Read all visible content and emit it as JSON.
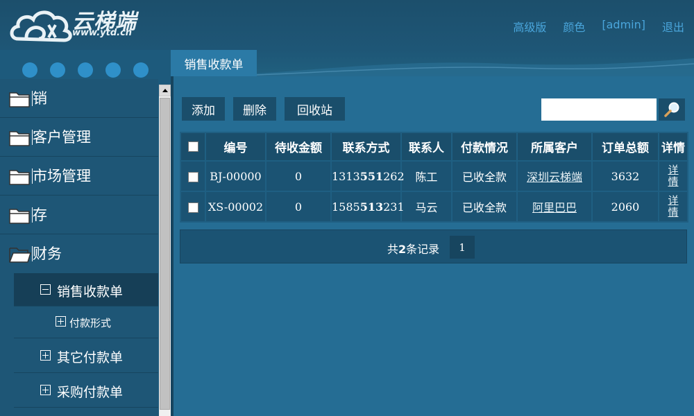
{
  "logo": {
    "cn": "云梯端",
    "en": "www.ytd.cn"
  },
  "top_links": [
    "高级版",
    "颜色",
    "[admin]",
    "退出"
  ],
  "sidebar": {
    "items": [
      {
        "label": "销"
      },
      {
        "label": "客户管理"
      },
      {
        "label": "市场管理"
      },
      {
        "label": "存"
      },
      {
        "label": "财务"
      }
    ],
    "finance_children": [
      {
        "label": "销售收款单",
        "state": "expanded"
      },
      {
        "label": "付款形式",
        "state": "collapsed"
      },
      {
        "label": "其它付款单",
        "state": "collapsed"
      },
      {
        "label": "采购付款单",
        "state": "collapsed"
      }
    ]
  },
  "tabs": {
    "active": "销售收款单"
  },
  "toolbar": {
    "add": "添加",
    "delete": "删除",
    "recycle": "回收站"
  },
  "search": {
    "value": "",
    "placeholder": ""
  },
  "table": {
    "headers": [
      "编号",
      "待收金额",
      "联系方式",
      "联系人",
      "付款情况",
      "所属客户",
      "订单总额",
      "详情"
    ],
    "rows": [
      {
        "id": "BJ-00000",
        "pending": "0",
        "contact_a": "1313",
        "contact_b": "551",
        "contact_c": "262",
        "person": "陈工",
        "payment": "已收全款",
        "customer": "深圳云梯端",
        "total": "3632",
        "detail_1": "详",
        "detail_2": "情"
      },
      {
        "id": "XS-00002",
        "pending": "0",
        "contact_a": "1585",
        "contact_b": "513",
        "contact_c": "231",
        "person": "马云",
        "payment": "已收全款",
        "customer": "阿里巴巴",
        "total": "2060",
        "detail_1": "详",
        "detail_2": "情"
      }
    ]
  },
  "pager": {
    "prefix": "共",
    "count": "2",
    "suffix": "条记录",
    "page": "1"
  },
  "colors": {
    "background": "#1d5a7c",
    "header": "#1c4f6c",
    "accent_link": "#4aa6dc",
    "dots": "#2f90c9",
    "button": "#1a4e6b",
    "table_cell": "#1b5373"
  }
}
